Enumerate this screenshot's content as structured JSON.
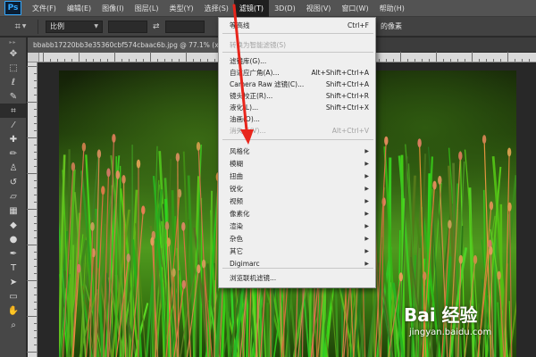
{
  "app": {
    "logo": "Ps"
  },
  "menubar": {
    "items": [
      {
        "label": "文件(F)"
      },
      {
        "label": "编辑(E)"
      },
      {
        "label": "图像(I)"
      },
      {
        "label": "图层(L)"
      },
      {
        "label": "类型(Y)"
      },
      {
        "label": "选择(S)"
      },
      {
        "label": "滤镜(T)"
      },
      {
        "label": "3D(D)"
      },
      {
        "label": "视图(V)"
      },
      {
        "label": "窗口(W)"
      },
      {
        "label": "帮助(H)"
      }
    ],
    "active_index": 6
  },
  "options": {
    "ratio_label": "比例",
    "delete_pixels_label": "的像素"
  },
  "document": {
    "tab_title": "bbabb17220bb3e35360cbf574cbaac6b.jpg @ 77.1% (x_la"
  },
  "filter_menu": {
    "items": [
      {
        "label": "等高线",
        "shortcut": "Ctrl+F",
        "disabled": false,
        "submenu": false
      },
      {
        "label": "转换为智能滤镜(S)",
        "shortcut": "",
        "disabled": true,
        "submenu": false
      },
      {
        "label": "滤镜库(G)...",
        "shortcut": "",
        "disabled": false,
        "submenu": false
      },
      {
        "label": "自适应广角(A)...",
        "shortcut": "Alt+Shift+Ctrl+A",
        "disabled": false,
        "submenu": false
      },
      {
        "label": "Camera Raw 滤镜(C)...",
        "shortcut": "Shift+Ctrl+A",
        "disabled": false,
        "submenu": false
      },
      {
        "label": "镜头校正(R)...",
        "shortcut": "Shift+Ctrl+R",
        "disabled": false,
        "submenu": false
      },
      {
        "label": "液化(L)...",
        "shortcut": "Shift+Ctrl+X",
        "disabled": false,
        "submenu": false
      },
      {
        "label": "油画(O)...",
        "shortcut": "",
        "disabled": false,
        "submenu": false
      },
      {
        "label": "消失点(V)...",
        "shortcut": "Alt+Ctrl+V",
        "disabled": true,
        "submenu": false
      },
      {
        "label": "风格化",
        "shortcut": "",
        "disabled": false,
        "submenu": true
      },
      {
        "label": "模糊",
        "shortcut": "",
        "disabled": false,
        "submenu": true
      },
      {
        "label": "扭曲",
        "shortcut": "",
        "disabled": false,
        "submenu": true
      },
      {
        "label": "锐化",
        "shortcut": "",
        "disabled": false,
        "submenu": true
      },
      {
        "label": "视频",
        "shortcut": "",
        "disabled": false,
        "submenu": true
      },
      {
        "label": "像素化",
        "shortcut": "",
        "disabled": false,
        "submenu": true
      },
      {
        "label": "渲染",
        "shortcut": "",
        "disabled": false,
        "submenu": true
      },
      {
        "label": "杂色",
        "shortcut": "",
        "disabled": false,
        "submenu": true
      },
      {
        "label": "其它",
        "shortcut": "",
        "disabled": false,
        "submenu": true
      },
      {
        "label": "Digimarc",
        "shortcut": "",
        "disabled": false,
        "submenu": true
      },
      {
        "label": "浏览联机滤镜...",
        "shortcut": "",
        "disabled": false,
        "submenu": false
      }
    ]
  },
  "tools": [
    {
      "icon": "move-icon"
    },
    {
      "icon": "marquee-icon"
    },
    {
      "icon": "lasso-icon"
    },
    {
      "icon": "quick-select-icon"
    },
    {
      "icon": "crop-icon"
    },
    {
      "icon": "eyedropper-icon"
    },
    {
      "icon": "healing-brush-icon"
    },
    {
      "icon": "brush-icon"
    },
    {
      "icon": "clone-stamp-icon"
    },
    {
      "icon": "history-brush-icon"
    },
    {
      "icon": "eraser-icon"
    },
    {
      "icon": "gradient-icon"
    },
    {
      "icon": "blur-icon"
    },
    {
      "icon": "dodge-icon"
    },
    {
      "icon": "pen-icon"
    },
    {
      "icon": "type-icon"
    },
    {
      "icon": "path-select-icon"
    },
    {
      "icon": "shape-icon"
    },
    {
      "icon": "hand-icon"
    },
    {
      "icon": "zoom-icon"
    }
  ],
  "watermark": {
    "brand": "Bai 经验",
    "url": "jingyan.baidu.com"
  },
  "colors": {
    "annotation_arrow": "#e8261c",
    "menu_bg": "#efefef",
    "ui_dark": "#535353"
  }
}
